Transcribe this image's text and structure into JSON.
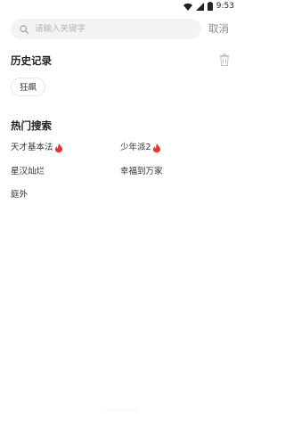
{
  "status_bar": {
    "time": "9:53",
    "icons": [
      "wifi-icon",
      "signal-icon",
      "battery-icon"
    ]
  },
  "search": {
    "placeholder": "请输入关键字",
    "value": "",
    "cancel_label": "取消"
  },
  "history": {
    "title": "历史记录",
    "clear_icon": "trash-icon",
    "items": [
      "狂飙"
    ]
  },
  "hot": {
    "title": "热门搜索",
    "hot_badge_icon": "flame-icon",
    "hot_badge_color": "#e8352b",
    "items": [
      {
        "label": "天才基本法",
        "hot": true
      },
      {
        "label": "少年派2",
        "hot": true
      },
      {
        "label": "星汉灿烂",
        "hot": false
      },
      {
        "label": "幸福到万家",
        "hot": false
      },
      {
        "label": "庭外",
        "hot": false
      }
    ]
  }
}
